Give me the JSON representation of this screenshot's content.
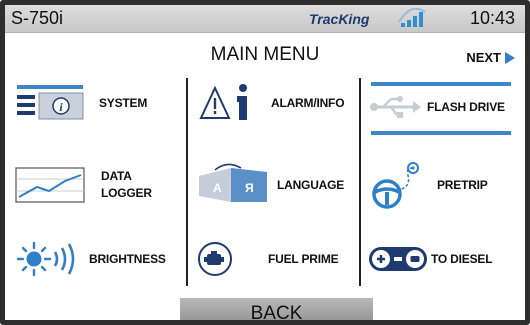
{
  "status_bar": {
    "model": "S-750i",
    "brand": "TracKing",
    "time": "10:43"
  },
  "title": "MAIN MENU",
  "next_label": "NEXT",
  "menu": {
    "system": "SYSTEM",
    "alarm_info": "ALARM/INFO",
    "flash_drive": "FLASH DRIVE",
    "data_logger_line1": "DATA",
    "data_logger_line2": "LOGGER",
    "language": "LANGUAGE",
    "pretrip": "PRETRIP",
    "brightness": "BRIGHTNESS",
    "fuel_prime": "FUEL PRIME",
    "to_diesel": "TO DIESEL"
  },
  "back_label": "BACK",
  "colors": {
    "accent_blue": "#3f86c8",
    "dark_blue": "#1f3a6e",
    "status_bar": "#d2d2d2"
  }
}
